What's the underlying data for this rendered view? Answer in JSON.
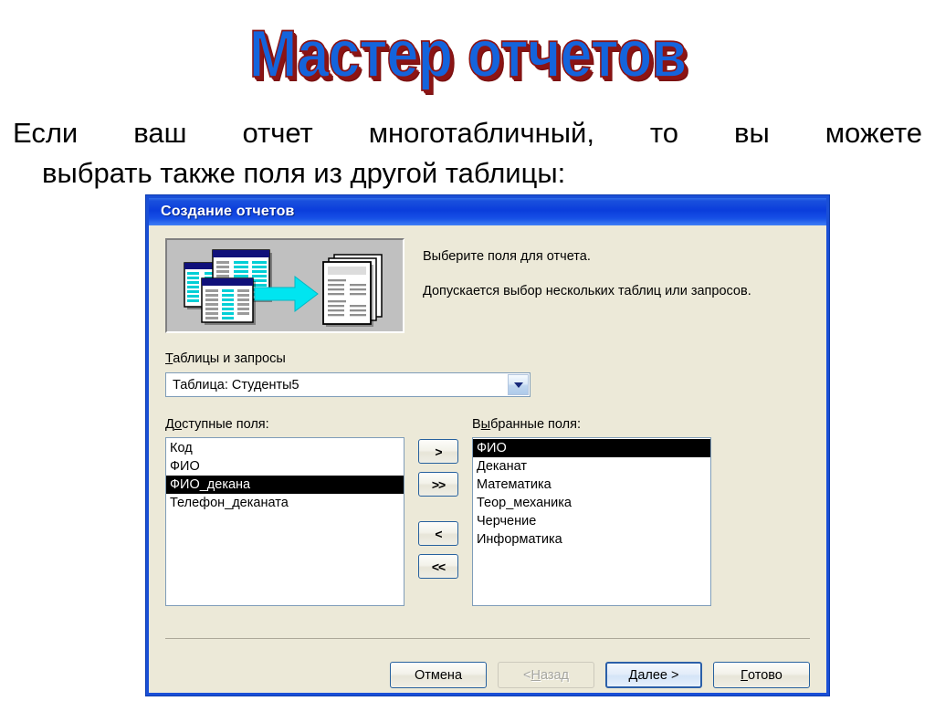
{
  "slide": {
    "title": "Мастер отчетов",
    "body_line1": "Если ваш отчет многотабличный, то вы можете",
    "body_line2": "выбрать также поля из другой таблицы:"
  },
  "dialog": {
    "title": "Создание отчетов",
    "illustration_name": "tables-to-report-illustration",
    "instruction_1": "Выберите поля для отчета.",
    "instruction_2": "Допускается выбор нескольких таблиц или запросов.",
    "tables_label_acc": "Т",
    "tables_label_rest": "аблицы и запросы",
    "combo_value": "Таблица: Студенты5",
    "available": {
      "label_pre": "Д",
      "label_acc": "о",
      "label_post": "ступные поля:",
      "items": [
        {
          "text": "Код",
          "selected": false
        },
        {
          "text": "ФИО",
          "selected": false
        },
        {
          "text": "ФИО_декана",
          "selected": true
        },
        {
          "text": "Телефон_деканата",
          "selected": false
        }
      ]
    },
    "selected": {
      "label_pre": "В",
      "label_acc": "ы",
      "label_post": "бранные поля:",
      "items": [
        {
          "text": "ФИО",
          "selected": true
        },
        {
          "text": "Деканат",
          "selected": false
        },
        {
          "text": "Математика",
          "selected": false
        },
        {
          "text": "Теор_механика",
          "selected": false
        },
        {
          "text": "Черчение",
          "selected": false
        },
        {
          "text": "Информатика",
          "selected": false
        }
      ]
    },
    "transfer_buttons": [
      {
        "label": ">",
        "name": "move-one-right-button"
      },
      {
        "label": ">>",
        "name": "move-all-right-button"
      },
      {
        "label": "<",
        "name": "move-one-left-button"
      },
      {
        "label": "<<",
        "name": "move-all-left-button"
      }
    ],
    "footer": {
      "cancel": "Отмена",
      "back_pre": "< ",
      "back_acc": "Н",
      "back_post": "азад",
      "next_acc": "Д",
      "next_post": "алее >",
      "finish_acc": "Г",
      "finish_post": "отово"
    }
  },
  "colors": {
    "title_fill": "#1464dc",
    "title_shadow": "#8c1414",
    "dialog_face": "#ece9d8",
    "titlebar_blue": "#0b3ddc",
    "selection": "#000000",
    "accent_border": "#27619e"
  }
}
